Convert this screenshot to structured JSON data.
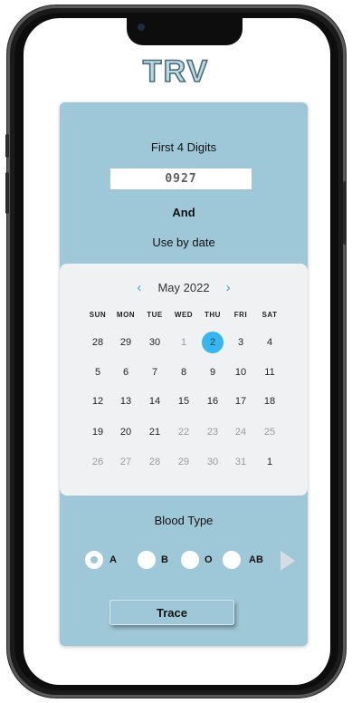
{
  "app": {
    "logo": "TRV"
  },
  "form": {
    "digits_label": "First 4 Digits",
    "digits_value": "0927",
    "and_label": "And",
    "use_by_label": "Use by date"
  },
  "calendar": {
    "month_label": "May 2022",
    "prev_icon": "chevron-left-icon",
    "next_icon": "chevron-right-icon",
    "weekdays": [
      "SUN",
      "MON",
      "TUE",
      "WED",
      "THU",
      "FRI",
      "SAT"
    ],
    "weeks": [
      [
        {
          "d": "28",
          "m": "cur"
        },
        {
          "d": "29",
          "m": "cur"
        },
        {
          "d": "30",
          "m": "cur"
        },
        {
          "d": "1",
          "m": "oth"
        },
        {
          "d": "2",
          "m": "sel"
        },
        {
          "d": "3",
          "m": "cur"
        },
        {
          "d": "4",
          "m": "cur"
        }
      ],
      [
        {
          "d": "5",
          "m": "cur"
        },
        {
          "d": "6",
          "m": "cur"
        },
        {
          "d": "7",
          "m": "cur"
        },
        {
          "d": "8",
          "m": "cur"
        },
        {
          "d": "9",
          "m": "cur"
        },
        {
          "d": "10",
          "m": "cur"
        },
        {
          "d": "11",
          "m": "cur"
        }
      ],
      [
        {
          "d": "12",
          "m": "cur"
        },
        {
          "d": "13",
          "m": "cur"
        },
        {
          "d": "14",
          "m": "cur"
        },
        {
          "d": "15",
          "m": "cur"
        },
        {
          "d": "16",
          "m": "cur"
        },
        {
          "d": "17",
          "m": "cur"
        },
        {
          "d": "18",
          "m": "cur"
        }
      ],
      [
        {
          "d": "19",
          "m": "cur"
        },
        {
          "d": "20",
          "m": "cur"
        },
        {
          "d": "21",
          "m": "cur"
        },
        {
          "d": "22",
          "m": "oth"
        },
        {
          "d": "23",
          "m": "oth"
        },
        {
          "d": "24",
          "m": "oth"
        },
        {
          "d": "25",
          "m": "oth"
        }
      ],
      [
        {
          "d": "26",
          "m": "oth"
        },
        {
          "d": "27",
          "m": "oth"
        },
        {
          "d": "28",
          "m": "oth"
        },
        {
          "d": "29",
          "m": "oth"
        },
        {
          "d": "30",
          "m": "oth"
        },
        {
          "d": "31",
          "m": "oth"
        },
        {
          "d": "1",
          "m": "cur"
        }
      ]
    ]
  },
  "blood": {
    "label": "Blood Type",
    "options": [
      "A",
      "B",
      "O",
      "AB"
    ],
    "selected": "A",
    "next_icon": "play-arrow-icon"
  },
  "actions": {
    "trace_label": "Trace"
  },
  "colors": {
    "card": "#9ec8d8",
    "selected_day": "#35b6ef",
    "chevron": "#3aa7e6"
  }
}
